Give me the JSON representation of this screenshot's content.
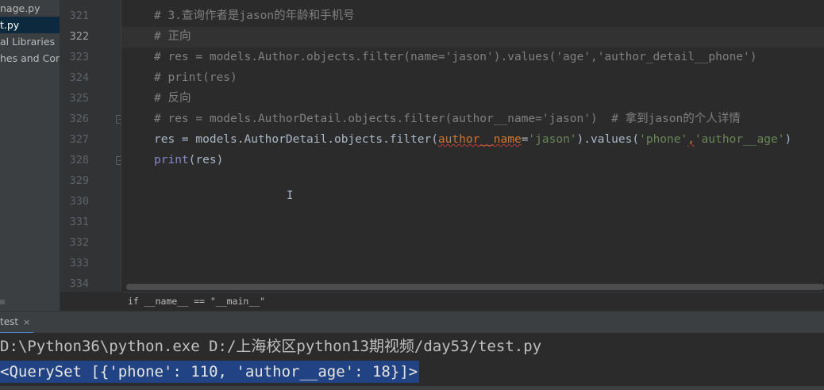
{
  "sidebar": {
    "items": [
      {
        "label": "nage.py",
        "selected": false
      },
      {
        "label": "t.py",
        "selected": true
      },
      {
        "label": "al Libraries",
        "selected": false
      },
      {
        "label": "hes and Cons",
        "selected": false
      }
    ]
  },
  "editor": {
    "line_numbers": [
      "321",
      "322",
      "323",
      "324",
      "325",
      "326",
      "327",
      "328",
      "329",
      "330",
      "331",
      "332",
      "333",
      "334"
    ],
    "current_line": "322",
    "lines": {
      "l321": "# 3.查询作者是jason的年龄和手机号",
      "l322": "# 正向",
      "l323": "# res = models.Author.objects.filter(name='jason').values('age','author_detail__phone')",
      "l324": "# print(res)",
      "l325": "# 反向",
      "l326": "# res = models.AuthorDetail.objects.filter(author__name='jason')  # 拿到jason的个人详情",
      "l327": {
        "p1": "res = models.AuthorDetail.objects.filter(",
        "p2": "author__name",
        "p3": "=",
        "p4": "'jason'",
        "p5": ").values(",
        "p6": "'phone'",
        "p7": ",",
        "p8": "'author__age'",
        "p9": ")"
      },
      "l328": {
        "fn": "print",
        "rest": "(res)"
      }
    },
    "breadcrumb": "if __name__ == \"__main__\""
  },
  "run_panel": {
    "tab_label": "test",
    "close": "×",
    "output": [
      "D:\\Python36\\python.exe D:/上海校区python13期视频/day53/test.py",
      "<QuerySet [{'phone': 110, 'author__age': 18}]>"
    ]
  },
  "colors": {
    "comment": "#808080",
    "string": "#6a8759",
    "keyword_arg": "#cc7832",
    "builtin": "#8888c6",
    "selection": "#214283"
  }
}
